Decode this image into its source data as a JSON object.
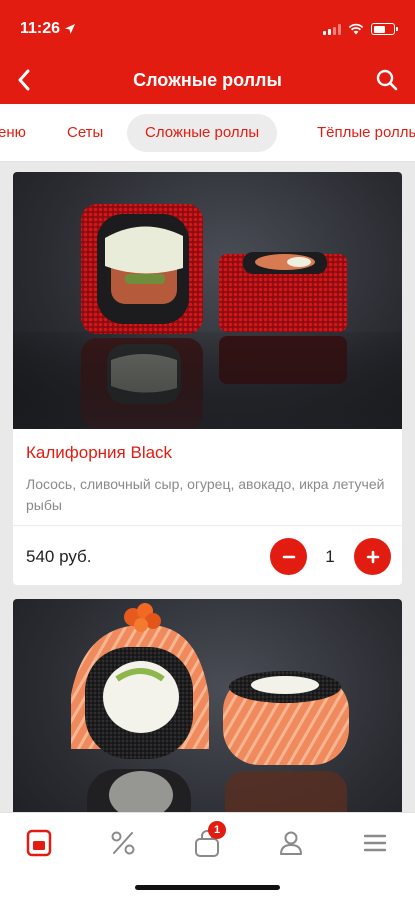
{
  "status_bar": {
    "time": "11:26"
  },
  "navbar": {
    "title": "Сложные роллы"
  },
  "tabs": [
    {
      "label": "еню"
    },
    {
      "label": "Сеты"
    },
    {
      "label": "Сложные роллы",
      "active": true
    },
    {
      "label": "Тёплые роллы"
    }
  ],
  "products": [
    {
      "name": "Калифорния Black",
      "description": "Лосось, сливочный сыр, огурец, авокадо, икра летучей рыбы",
      "price": "540 руб.",
      "quantity": "1",
      "image": "black-tobiko-roll-photo"
    },
    {
      "image": "salmon-black-roll-photo"
    }
  ],
  "bottom_nav": {
    "items": [
      "menu-icon",
      "discount-icon",
      "cart-icon",
      "profile-icon",
      "more-icon"
    ],
    "cart_badge": "1"
  },
  "colors": {
    "accent": "#e31c12",
    "muted": "#8a8a8a",
    "background": "#e9e9e9"
  }
}
